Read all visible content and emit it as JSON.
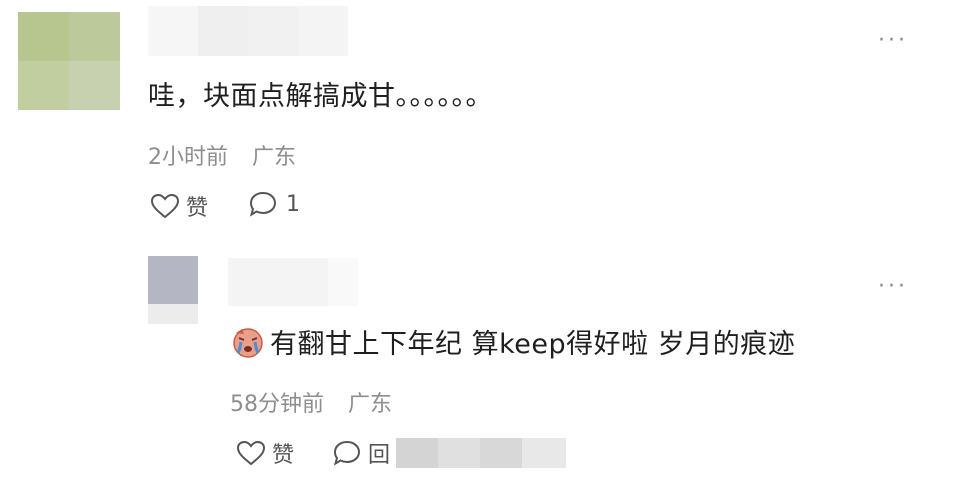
{
  "comment": {
    "text": "哇，块面点解搞成甘。。。。。。",
    "time": "2小时前",
    "location": "广东",
    "like_label": "赞",
    "reply_count": "1",
    "more": "···",
    "like_icon": "heart-outline-icon",
    "reply_icon": "speech-bubble-icon"
  },
  "reply": {
    "text": "有翻甘上下年纪 算keep得好啦 岁月的痕迹",
    "emoji": "crying-face-emoji",
    "time": "58分钟前",
    "location": "广东",
    "like_label": "赞",
    "reply_label": "回",
    "more": "···"
  },
  "colors": {
    "text": "#1f1f1f",
    "meta": "#8e8e8e",
    "icon": "#555555"
  }
}
